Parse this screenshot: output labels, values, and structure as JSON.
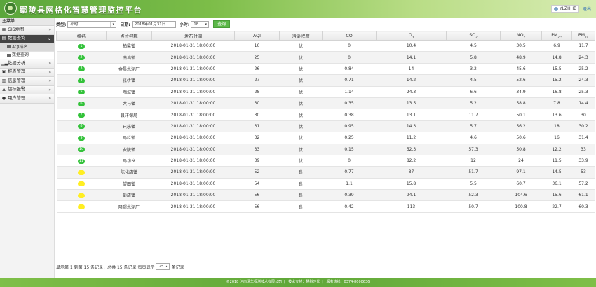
{
  "header": {
    "app_title": "鄢陵县网格化智慧管理监控平台",
    "user": "YLZHHB",
    "logout": "退出"
  },
  "sidebar": {
    "title": "主菜单",
    "items": [
      {
        "label": "GIS地图",
        "icon": "map-icon",
        "arrow": "»"
      },
      {
        "label": "数据查询",
        "icon": "database-icon",
        "arrow": "⌄",
        "active": true,
        "sub": [
          {
            "label": "AQI排名",
            "active": true
          },
          {
            "label": "数据查询",
            "active": false
          }
        ]
      },
      {
        "label": "数据分析",
        "icon": "chart-icon",
        "arrow": "»"
      },
      {
        "label": "报表管理",
        "icon": "report-icon",
        "arrow": "»"
      },
      {
        "label": "信息管理",
        "icon": "info-icon",
        "arrow": "»"
      },
      {
        "label": "超标报警",
        "icon": "alarm-icon",
        "arrow": "»"
      },
      {
        "label": "用户管理",
        "icon": "user-icon",
        "arrow": "»"
      }
    ]
  },
  "filters": {
    "type_label": "类型:",
    "type_value": "小时",
    "date_label": "日期:",
    "date_value": "2018年01月31日",
    "hour_label": "小时:",
    "hour_value": "18",
    "query_button": "查询"
  },
  "table": {
    "columns": [
      "排名",
      "点位名称",
      "发布时间",
      "AQI",
      "污染程度",
      "CO",
      "O3",
      "SO2",
      "NO2",
      "PM2.5",
      "PM10"
    ],
    "rows": [
      {
        "rank": "1",
        "level": "good",
        "cells": [
          "柏梁镇",
          "2018-01-31 18:00:00",
          "16",
          "优",
          "0",
          "10.4",
          "4.5",
          "30.5",
          "6.9",
          "11.7"
        ]
      },
      {
        "rank": "2",
        "level": "good",
        "cells": [
          "南坞镇",
          "2018-01-31 18:00:00",
          "25",
          "优",
          "0",
          "14.1",
          "5.8",
          "48.9",
          "14.8",
          "24.3"
        ]
      },
      {
        "rank": "3",
        "level": "good",
        "cells": [
          "金晨水泥厂",
          "2018-01-31 18:00:00",
          "26",
          "优",
          "0.84",
          "14",
          "3.2",
          "45.6",
          "15.5",
          "25.2"
        ]
      },
      {
        "rank": "4",
        "level": "good",
        "cells": [
          "张桥镇",
          "2018-01-31 18:00:00",
          "27",
          "优",
          "0.71",
          "14.2",
          "4.5",
          "52.6",
          "15.2",
          "24.3"
        ]
      },
      {
        "rank": "5",
        "level": "good",
        "cells": [
          "陶城镇",
          "2018-01-31 18:00:00",
          "28",
          "优",
          "1.14",
          "24.3",
          "6.6",
          "34.9",
          "16.8",
          "25.3"
        ]
      },
      {
        "rank": "6",
        "level": "good",
        "cells": [
          "大马镇",
          "2018-01-31 18:00:00",
          "30",
          "优",
          "0.35",
          "13.5",
          "5.2",
          "58.8",
          "7.8",
          "14.4"
        ]
      },
      {
        "rank": "7",
        "level": "good",
        "cells": [
          "县环保局",
          "2018-01-31 18:00:00",
          "30",
          "优",
          "0.38",
          "13.1",
          "11.7",
          "50.1",
          "13.6",
          "30"
        ]
      },
      {
        "rank": "8",
        "level": "good",
        "cells": [
          "只乐镇",
          "2018-01-31 18:00:00",
          "31",
          "优",
          "0.95",
          "14.3",
          "5.7",
          "56.2",
          "18",
          "30.2"
        ]
      },
      {
        "rank": "9",
        "level": "good",
        "cells": [
          "马栏镇",
          "2018-01-31 18:00:00",
          "32",
          "优",
          "0.25",
          "11.2",
          "4.6",
          "50.6",
          "16",
          "31.4"
        ]
      },
      {
        "rank": "10",
        "level": "good",
        "cells": [
          "安陵镇",
          "2018-01-31 18:00:00",
          "33",
          "优",
          "0.15",
          "52.3",
          "57.3",
          "50.8",
          "12.2",
          "33"
        ]
      },
      {
        "rank": "11",
        "level": "good",
        "cells": [
          "马坊乡",
          "2018-01-31 18:00:00",
          "39",
          "优",
          "0",
          "82.2",
          "12",
          "24",
          "11.5",
          "33.9"
        ]
      },
      {
        "rank": "12",
        "level": "moderate",
        "cells": [
          "陈化店镇",
          "2018-01-31 18:00:00",
          "52",
          "良",
          "0.77",
          "87",
          "51.7",
          "97.1",
          "14.5",
          "53"
        ]
      },
      {
        "rank": "13",
        "level": "moderate",
        "cells": [
          "望田镇",
          "2018-01-31 18:00:00",
          "54",
          "良",
          "1.1",
          "15.8",
          "5.5",
          "60.7",
          "36.1",
          "57.2"
        ]
      },
      {
        "rank": "14",
        "level": "moderate",
        "cells": [
          "彭店镇",
          "2018-01-31 18:00:00",
          "56",
          "良",
          "0.39",
          "94.1",
          "52.3",
          "104.6",
          "15.6",
          "61.1"
        ]
      },
      {
        "rank": "15",
        "level": "moderate",
        "cells": [
          "隆璟水泥厂",
          "2018-01-31 18:00:00",
          "56",
          "良",
          "0.42",
          "113",
          "50.7",
          "100.8",
          "22.7",
          "60.3"
        ]
      }
    ]
  },
  "pagination": {
    "summary": "显示第 1 到第 15 条记录，总共 15 条记录 每页显示",
    "per_page": "25",
    "suffix": "条记录"
  },
  "footer": {
    "copyright": "©2018 河南清华视测技术有限公司",
    "support": "技术支持：慧科时代",
    "hotline": "服务热线：0374-8000636"
  },
  "colors": {
    "header_green": "#5aa63c",
    "badge_good": "#33c23a",
    "badge_moderate": "#ffee22",
    "button_green": "#5bb848"
  }
}
